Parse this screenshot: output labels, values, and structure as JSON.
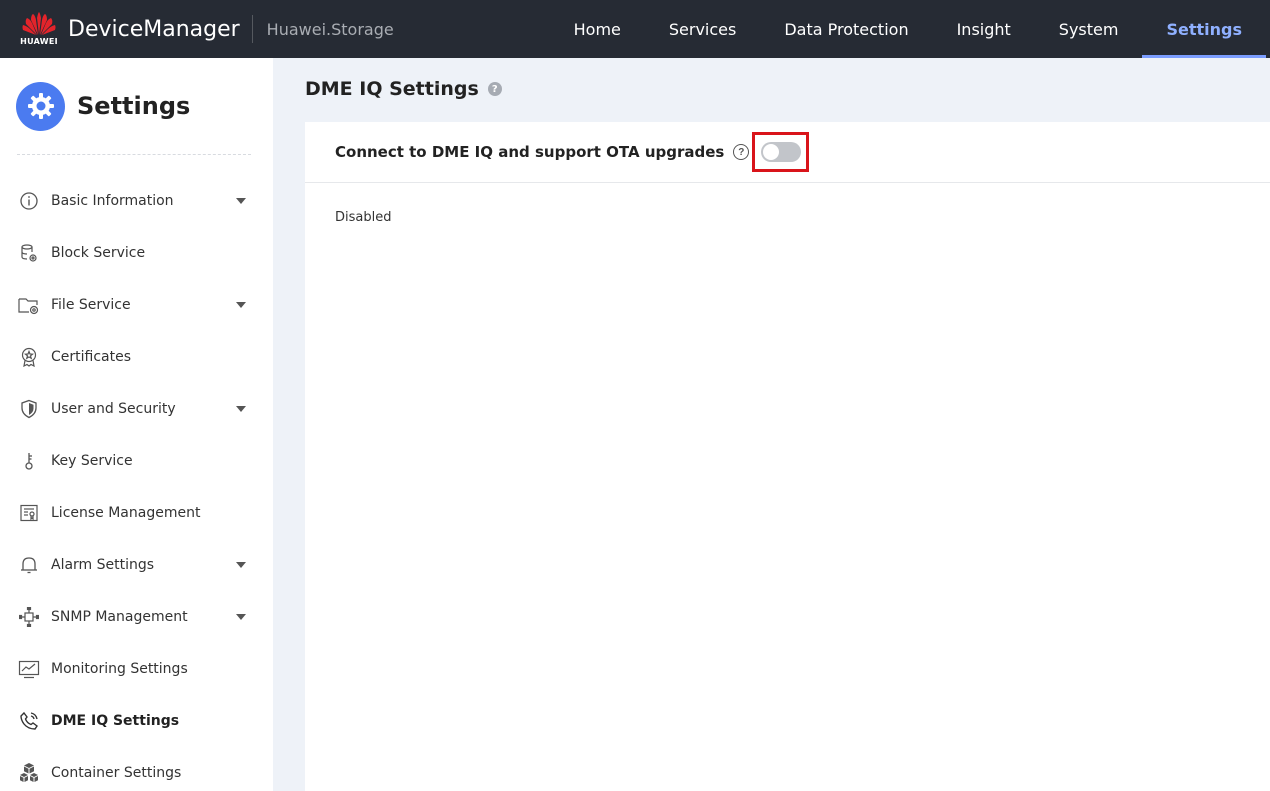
{
  "brand": {
    "logo_text": "HUAWEI",
    "app_name": "DeviceManager",
    "product": "Huawei.Storage"
  },
  "nav": [
    {
      "label": "Home"
    },
    {
      "label": "Services"
    },
    {
      "label": "Data Protection"
    },
    {
      "label": "Insight"
    },
    {
      "label": "System"
    },
    {
      "label": "Settings",
      "active": true
    }
  ],
  "sidebar": {
    "title": "Settings",
    "items": [
      {
        "label": "Basic Information",
        "icon": "info-icon",
        "expandable": true
      },
      {
        "label": "Block Service",
        "icon": "database-icon",
        "expandable": false
      },
      {
        "label": "File Service",
        "icon": "folder-gear-icon",
        "expandable": true
      },
      {
        "label": "Certificates",
        "icon": "certificate-icon",
        "expandable": false
      },
      {
        "label": "User and Security",
        "icon": "shield-icon",
        "expandable": true
      },
      {
        "label": "Key Service",
        "icon": "key-icon",
        "expandable": false
      },
      {
        "label": "License Management",
        "icon": "license-icon",
        "expandable": false
      },
      {
        "label": "Alarm Settings",
        "icon": "bell-icon",
        "expandable": true
      },
      {
        "label": "SNMP Management",
        "icon": "network-icon",
        "expandable": true
      },
      {
        "label": "Monitoring Settings",
        "icon": "monitor-chart-icon",
        "expandable": false
      },
      {
        "label": "DME IQ Settings",
        "icon": "phone-icon",
        "expandable": false,
        "active": true
      },
      {
        "label": "Container Settings",
        "icon": "cubes-icon",
        "expandable": false
      }
    ]
  },
  "main": {
    "title": "DME IQ Settings",
    "setting_label": "Connect to DME IQ and support OTA upgrades",
    "toggle_on": false,
    "status": "Disabled"
  },
  "colors": {
    "topbar": "#262b34",
    "accent": "#4b7bf0",
    "nav_active": "#8fb0ff",
    "highlight": "#d9141a"
  }
}
